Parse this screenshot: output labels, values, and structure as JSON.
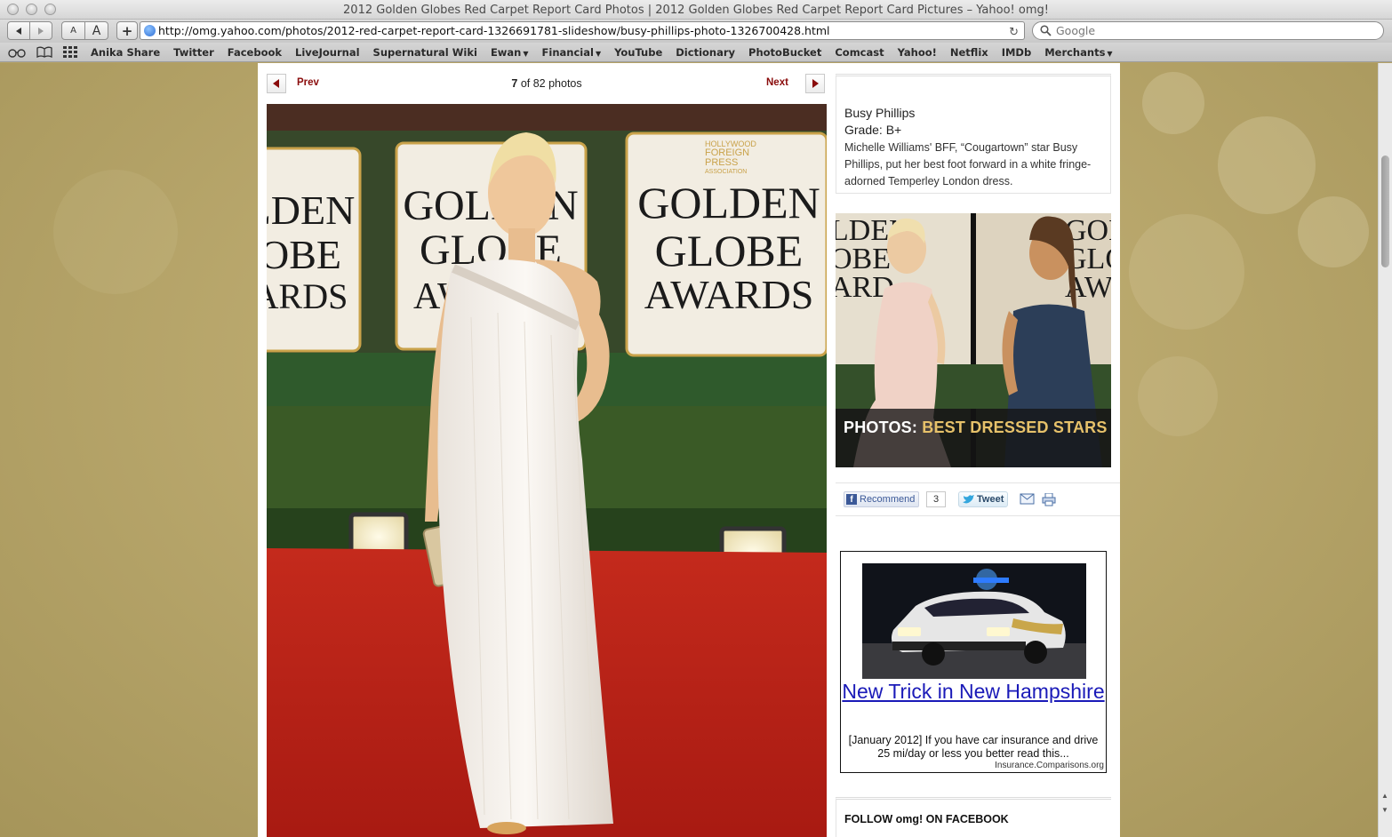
{
  "window": {
    "title": "2012 Golden Globes Red Carpet Report Card Photos | 2012 Golden Globes Red Carpet Report Card Pictures – Yahoo! omg!"
  },
  "toolbar": {
    "text_small": "A",
    "text_large": "A",
    "add": "+",
    "url": "http://omg.yahoo.com/photos/2012-red-carpet-report-card-1326691781-slideshow/busy-phillips-photo-1326700428.html",
    "search_placeholder": "Google"
  },
  "bookmarks": [
    {
      "label": "Anika Share",
      "menu": false
    },
    {
      "label": "Twitter",
      "menu": false
    },
    {
      "label": "Facebook",
      "menu": false
    },
    {
      "label": "LiveJournal",
      "menu": false
    },
    {
      "label": "Supernatural Wiki",
      "menu": false
    },
    {
      "label": "Ewan",
      "menu": true
    },
    {
      "label": "Financial",
      "menu": true
    },
    {
      "label": "YouTube",
      "menu": false
    },
    {
      "label": "Dictionary",
      "menu": false
    },
    {
      "label": "PhotoBucket",
      "menu": false
    },
    {
      "label": "Comcast",
      "menu": false
    },
    {
      "label": "Yahoo!",
      "menu": false
    },
    {
      "label": "Netflix",
      "menu": false
    },
    {
      "label": "IMDb",
      "menu": false
    },
    {
      "label": "Merchants",
      "menu": true
    }
  ],
  "slideshow": {
    "prev_label": "Prev",
    "next_label": "Next",
    "current": "7",
    "of_text": "of 82 photos"
  },
  "photo": {
    "backdrop_text": [
      "GOLDEN",
      "GLOBE",
      "AWARDS"
    ],
    "backdrop_left": [
      "LDEN",
      "OBE",
      "ARDS"
    ],
    "hfpa_text": [
      "HOLLYWOOD",
      "FOREIGN",
      "PRESS",
      "ASSOCIATION"
    ]
  },
  "caption": {
    "name": "Busy Phillips",
    "grade": "Grade: B+",
    "description": "Michelle Williams' BFF, “Cougartown” star Busy Phillips, put her best foot forward in a white fringe-adorned Temperley London dress."
  },
  "promo": {
    "prefix": "PHOTOS:",
    "highlight": "BEST DRESSED STARS",
    "backdrop_left": [
      "LDEN",
      "OBE",
      "ARD"
    ],
    "backdrop_right": [
      "GOL",
      "GLO",
      "AW"
    ]
  },
  "share": {
    "recommend_label": "Recommend",
    "recommend_count": "3",
    "tweet_label": "Tweet"
  },
  "ad": {
    "title": "New Trick in New Hampshire",
    "body": "[January 2012] If you have car insurance and drive 25 mi/day or less you better read this...",
    "source": "Insurance.Comparisons.org"
  },
  "follow": {
    "label": "FOLLOW omg! ON FACEBOOK"
  }
}
